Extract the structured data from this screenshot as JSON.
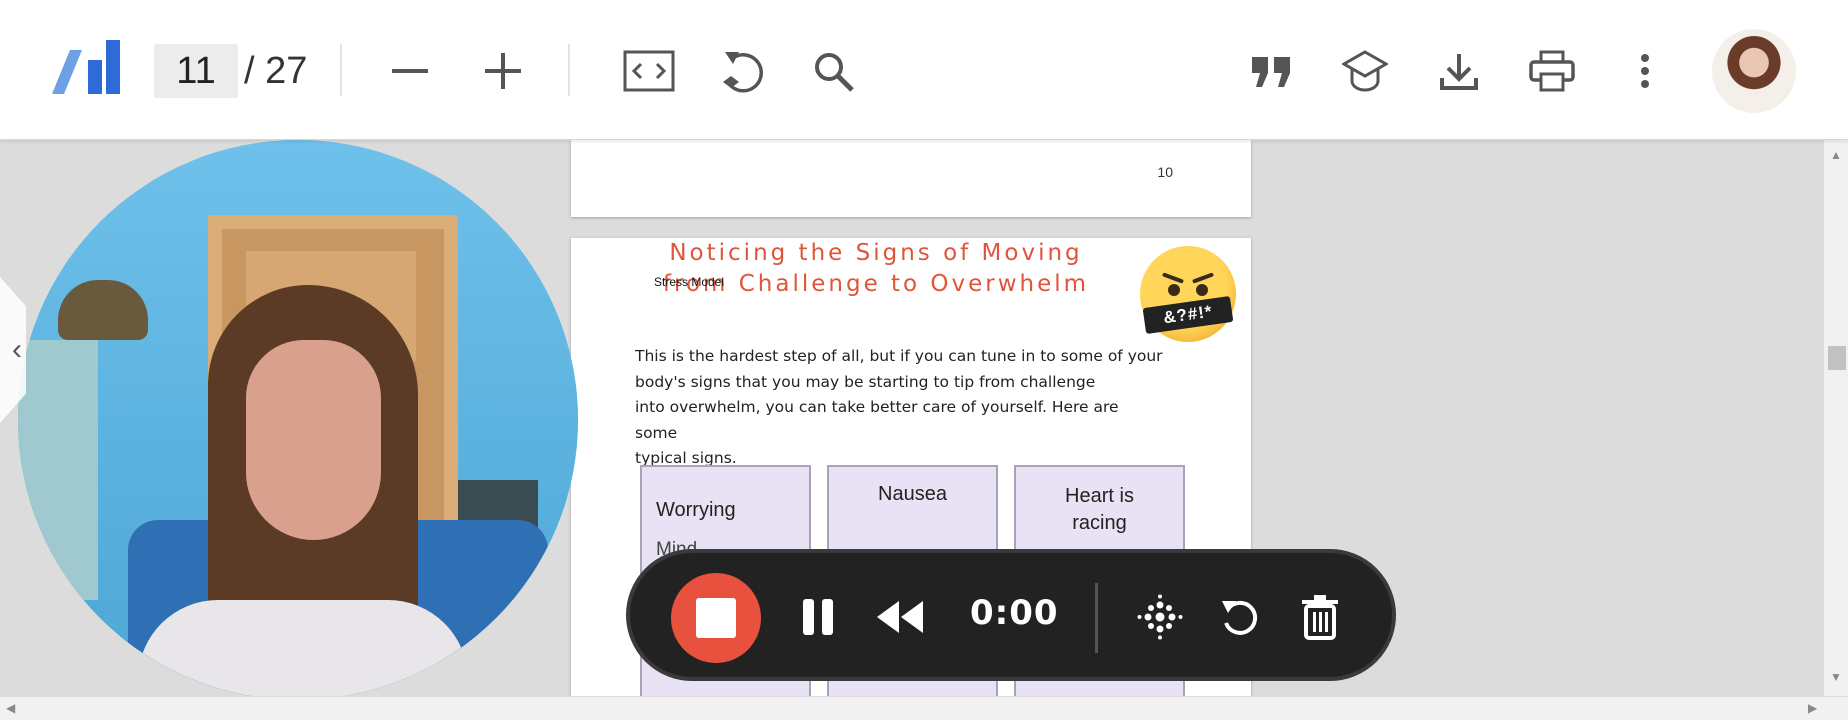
{
  "toolbar": {
    "logo": "app-logo",
    "page_current": "11",
    "page_total": "/ 27",
    "icons": [
      "zoom-out-icon",
      "zoom-in-icon",
      "fit-width-icon",
      "rotate-icon",
      "search-icon",
      "quote-icon",
      "graduation-cap-icon",
      "download-icon",
      "print-icon",
      "more-vert-icon"
    ],
    "avatar": "user-avatar"
  },
  "document": {
    "prev_page_number": "10",
    "title_line1": "Noticing the Signs of Moving",
    "title_line2": "from Challenge to Overwhelm",
    "side_label": "Stress Model",
    "emoji_text": "&?#!*",
    "paragraph_lines": [
      "This is the hardest step of all, but if you can tune in to some of your",
      "body's signs that you may be starting to tip from challenge",
      "into overwhelm, you can take better care of yourself. Here are some",
      "typical signs."
    ],
    "cards": [
      {
        "label": "Worrying",
        "sub": "Mind"
      },
      {
        "label": "Nausea",
        "sub": ""
      },
      {
        "label": "Heart is racing",
        "sub": ""
      }
    ]
  },
  "recorder": {
    "timer": "0:00",
    "buttons": [
      "stop-record-button",
      "pause-button",
      "rewind-button",
      "effects-button",
      "restart-button",
      "delete-button"
    ]
  },
  "colors": {
    "title": "#e0553a",
    "record": "#e8513e",
    "recorder_bg": "#222222",
    "logo_light": "#6ea0e6",
    "logo_dark": "#2f6bd6"
  }
}
